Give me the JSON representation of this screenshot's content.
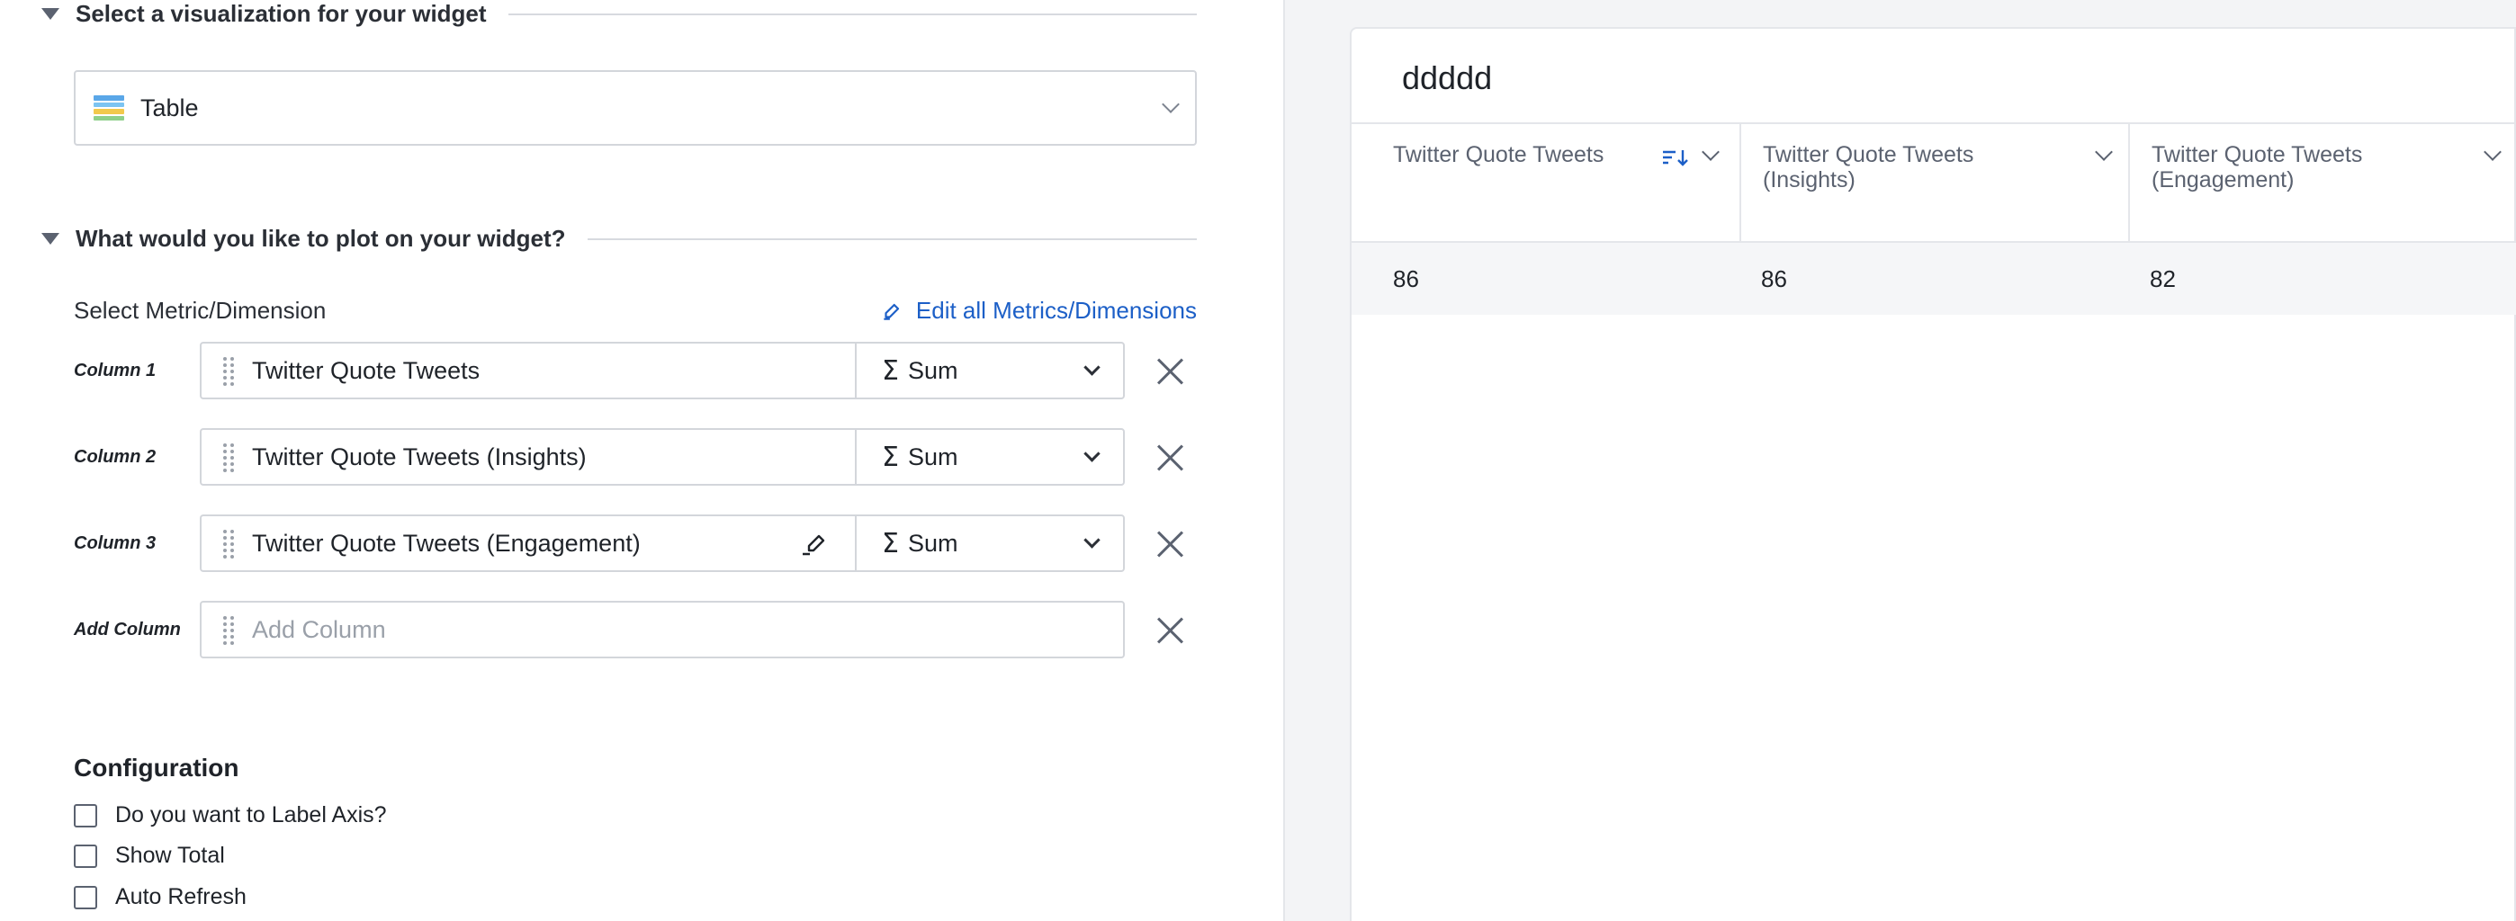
{
  "sections": {
    "viz_title": "Select a visualization for your widget",
    "plot_title": "What would you like to plot on your widget?"
  },
  "visualization": {
    "selected": "Table",
    "icon": "table-icon"
  },
  "metrics": {
    "label": "Select Metric/Dimension",
    "edit_all": "Edit all Metrics/Dimensions",
    "columns": [
      {
        "row_label": "Column 1",
        "value": "Twitter Quote Tweets",
        "aggregation": "Sum"
      },
      {
        "row_label": "Column 2",
        "value": "Twitter Quote Tweets (Insights)",
        "aggregation": "Sum"
      },
      {
        "row_label": "Column 3",
        "value": "Twitter Quote Tweets (Engagement)",
        "aggregation": "Sum"
      }
    ],
    "add_column": {
      "row_label": "Add Column",
      "placeholder": "Add Column"
    },
    "sigma": "Σ"
  },
  "configuration": {
    "title": "Configuration",
    "options": [
      {
        "label": "Do you want to Label Axis?",
        "checked": false
      },
      {
        "label": "Show Total",
        "checked": false
      },
      {
        "label": "Auto Refresh",
        "checked": false
      }
    ]
  },
  "widget": {
    "title": "ddddd",
    "headers": [
      "Twitter Quote Tweets",
      "Twitter Quote Tweets (Insights)",
      "Twitter Quote Tweets (Engagement)"
    ],
    "rows": [
      [
        "86",
        "86",
        "82"
      ]
    ]
  },
  "colors": {
    "accent": "#1c5fc7",
    "panel_bg": "#f3f4f6",
    "border": "#d3d6db"
  }
}
